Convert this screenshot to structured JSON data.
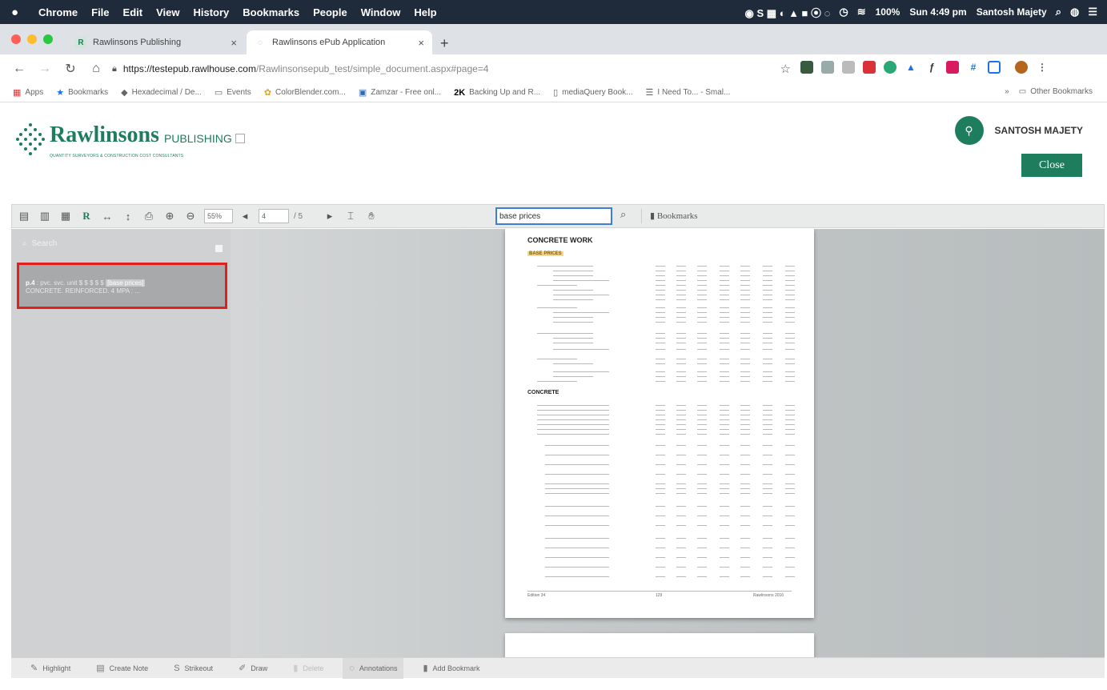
{
  "menubar": {
    "apple_icon": "apple-icon",
    "items": [
      "Chrome",
      "File",
      "Edit",
      "View",
      "History",
      "Bookmarks",
      "People",
      "Window",
      "Help"
    ],
    "battery": "100%",
    "clock": "Sun 4:49 pm",
    "user": "Santosh Majety"
  },
  "tabs": [
    {
      "title": "Rawlinsons Publishing",
      "favicon": "R",
      "active": false
    },
    {
      "title": "Rawlinsons ePub Application",
      "favicon": "globe",
      "active": true
    }
  ],
  "address": {
    "host": "https://testepub.rawlhouse.com",
    "path": "/Rawlinsonsepub_test/simple_document.aspx#page=4"
  },
  "bookmarks": {
    "items": [
      "Apps",
      "Bookmarks",
      "Hexadecimal / De...",
      "Events",
      "ColorBlender.com...",
      "Zamzar - Free onl...",
      "Backing Up and R...",
      "mediaQuery Book...",
      "I Need To... - Smal..."
    ],
    "other": "Other Bookmarks"
  },
  "header": {
    "brand": "Rawlinsons",
    "brand_suffix": "PUBLISHING",
    "tagline": "QUANTITY SURVEYORS & CONSTRUCTION COST CONSULTANTS",
    "user_name": "SANTOSH MAJETY",
    "close_label": "Close"
  },
  "viewer_toolbar": {
    "zoom": "55%",
    "page": "4",
    "page_total": "/ 5",
    "search_value": "base prices",
    "bookmarks_label": "Bookmarks"
  },
  "sidebar": {
    "search_label": "Search",
    "result_page": "p.4",
    "result_text_before": ": pvc. svc. unit $ $ $ $ $",
    "result_match": "[base prices]",
    "result_text_after": "CONCRETE. REINFORCED. 4 MPA : ..."
  },
  "document": {
    "title": "CONCRETE WORK",
    "subtitle": "BASE PRICES",
    "section2": "CONCRETE",
    "footer_left": "Edition 34",
    "footer_center": "129",
    "footer_right": "Rawlinsons 2016"
  },
  "bottom_toolbar": {
    "items": [
      {
        "label": "Highlight",
        "icon": "highlight-icon"
      },
      {
        "label": "Create Note",
        "icon": "note-icon"
      },
      {
        "label": "Strikeout",
        "icon": "strikeout-icon"
      },
      {
        "label": "Draw",
        "icon": "draw-icon"
      },
      {
        "label": "Delete",
        "icon": "delete-icon"
      },
      {
        "label": "Annotations",
        "icon": "annotations-icon"
      },
      {
        "label": "Add Bookmark",
        "icon": "bookmark-icon"
      }
    ]
  },
  "colors": {
    "brand": "#1e7d5c",
    "highlight_border": "#e0201c",
    "search_focus": "#3c7ee0"
  }
}
